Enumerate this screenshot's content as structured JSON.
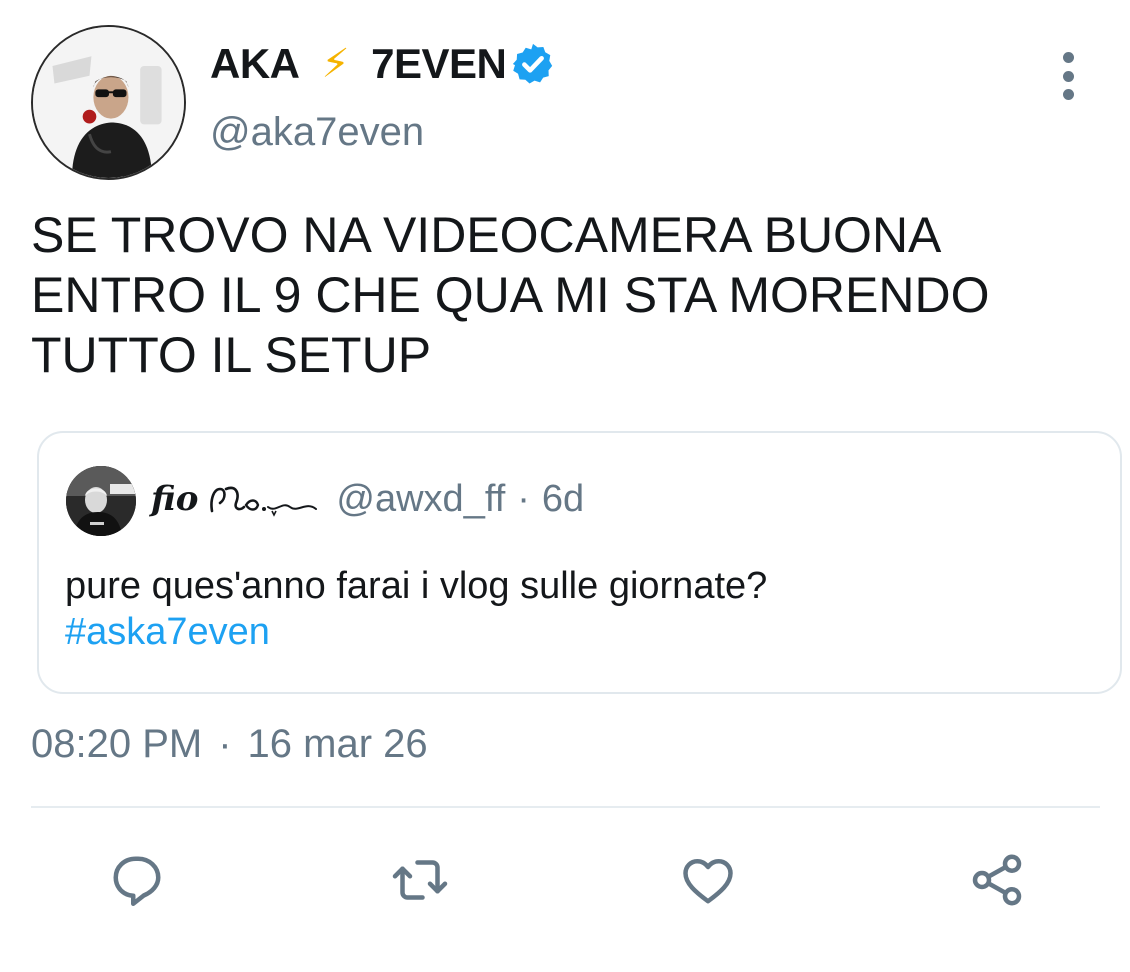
{
  "tweet": {
    "author": {
      "name_part1": "AKA",
      "name_emoji": "⚡",
      "name_part2": "7EVEN",
      "handle": "@aka7even",
      "avatar_icon": "profile-photo"
    },
    "text_lines": [
      "SE TROVO NA VIDEOCAMERA BUONA",
      "ENTRO IL 9 CHE QUA MI STA MORENDO",
      "TUTTO IL SETUP"
    ],
    "quoted": {
      "name": "fio",
      "handle": "@awxd_ff",
      "separator": "·",
      "time": "6d",
      "text": "pure ques'anno farai i vlog sulle giornate?",
      "hashtag": "#aska7even"
    },
    "timestamp": {
      "time": "08:20 PM",
      "separator": "·",
      "date": "16 mar 26"
    }
  },
  "actions": [
    {
      "name": "reply",
      "icon": "speech-bubble-icon"
    },
    {
      "name": "retweet",
      "icon": "retweet-icon"
    },
    {
      "name": "like",
      "icon": "heart-icon"
    },
    {
      "name": "share",
      "icon": "share-icon"
    }
  ],
  "colors": {
    "text": "#14171a",
    "secondary": "#657786",
    "link": "#1da1f2",
    "verified": "#1da1f2",
    "bolt": "#f5b300",
    "border": "#e1e8ed"
  }
}
